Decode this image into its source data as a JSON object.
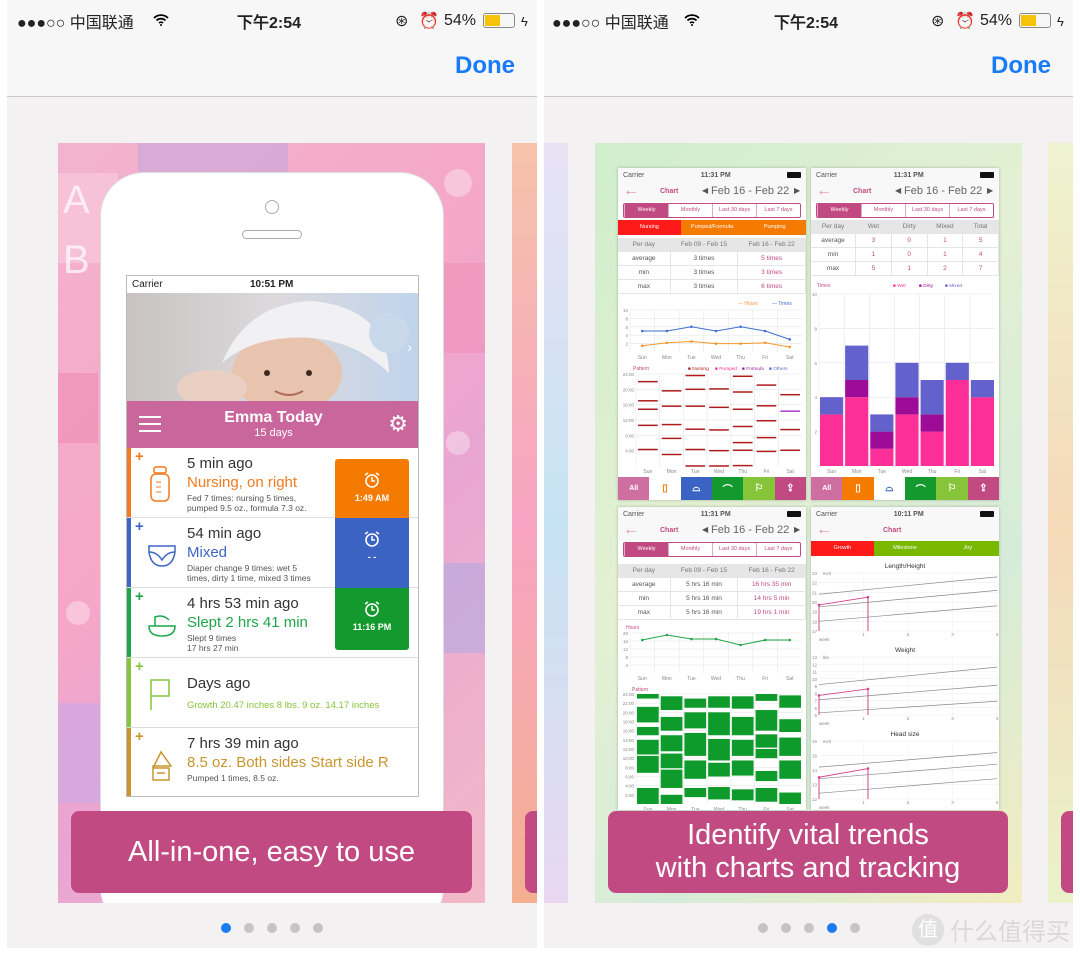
{
  "status_bar": {
    "carrier": "●●●○○ 中国联通",
    "time": "下午2:54",
    "battery": "54%",
    "battery_level": 0.54
  },
  "nav": {
    "done_label": "Done"
  },
  "left_slide": {
    "caption": "All-in-one, easy to use",
    "phone": {
      "carrier": "Carrier",
      "time": "10:51 PM",
      "header_title": "Emma Today",
      "header_subtitle": "15 days",
      "rows": [
        {
          "type": "feeding",
          "color": "#f47a1f",
          "time_ago": "5 min ago",
          "title": "Nursing, on right",
          "detail": "Fed 7 times: nursing 5 times,",
          "detail2": "pumped 9.5 oz., formula 7.3 oz.",
          "alarm": "1:49 AM",
          "alarm_color": "#f47a00"
        },
        {
          "type": "diaper",
          "color": "#3d66c4",
          "time_ago": "54 min ago",
          "title": "Mixed",
          "detail": "Diaper change 9 times: wet 5",
          "detail2": "times, dirty 1 time, mixed 3 times",
          "alarm": "- -",
          "alarm_color": "#3a63c3"
        },
        {
          "type": "sleep",
          "color": "#1fa64a",
          "time_ago": "4 hrs 53 min ago",
          "title": "Slept 2 hrs 41 min",
          "detail": "Slept 9 times",
          "detail2": "17 hrs 27 min",
          "alarm": "11:16 PM",
          "alarm_color": "#14992f"
        },
        {
          "type": "growth",
          "color": "#86c43a",
          "time_ago": "Days ago",
          "title": "",
          "detail": "Growth 20.47 inches 8 lbs. 9 oz. 14.17 inches",
          "detail2": ""
        },
        {
          "type": "pumping",
          "color": "#c9962e",
          "time_ago": "7 hrs 39 min ago",
          "title": "8.5 oz.  Both sides  Start side R",
          "detail": "Pumped 1 times, 8.5 oz.",
          "detail2": ""
        }
      ]
    },
    "page_dots": {
      "count": 5,
      "active": 0
    }
  },
  "right_slide": {
    "caption_line1": "Identify vital trends",
    "caption_line2": "with charts and tracking",
    "page_dots": {
      "count": 5,
      "active": 3
    },
    "screens": {
      "common": {
        "carrier": "Carrier",
        "chart_title": "Chart",
        "date_range": "Feb 16 - Feb 22",
        "segments": [
          "Weekly",
          "Monthly",
          "Last 30 days",
          "Last 7 days"
        ],
        "bottom_tabs": [
          "All"
        ]
      },
      "feeding": {
        "time": "11:31 PM",
        "tabs": [
          "Nursing",
          "Pumped/Formula",
          "Pumping"
        ],
        "table_header": [
          "Per day",
          "Feb 09 - Feb 15",
          "Feb 16 - Feb 22"
        ],
        "table_rows": [
          [
            "average",
            "3 times",
            "5 times"
          ],
          [
            "min",
            "3 times",
            "3 times"
          ],
          [
            "max",
            "3 times",
            "6 times"
          ]
        ]
      },
      "diaper": {
        "time": "11:31 PM",
        "table_header": [
          "Per day",
          "Wet",
          "Dirty",
          "Mixed",
          "Total"
        ],
        "table_rows": [
          [
            "average",
            "3",
            "0",
            "1",
            "5"
          ],
          [
            "min",
            "1",
            "0",
            "1",
            "4"
          ],
          [
            "max",
            "5",
            "1",
            "2",
            "7"
          ]
        ]
      },
      "sleep": {
        "time": "11:31 PM",
        "table_header": [
          "Per day",
          "Feb 09 - Feb 15",
          "Feb 16 - Feb 22"
        ],
        "table_rows": [
          [
            "average",
            "5 hrs 16 min",
            "16 hrs 35 min"
          ],
          [
            "min",
            "5 hrs 16 min",
            "14 hrs 5 min"
          ],
          [
            "max",
            "5 hrs 16 min",
            "19 hrs 1 min"
          ]
        ]
      },
      "growth": {
        "time": "10:11 PM",
        "tabs": [
          "Growth",
          "Milestone",
          "Joy"
        ]
      }
    }
  },
  "watermark": "什么值得买",
  "colors": {
    "accent": "#1a7cf5",
    "brand_pink": "#c24a82",
    "feeding": "#f47a00",
    "diaper": "#3a63c3",
    "sleep": "#14992f",
    "growth": "#86c43a",
    "pumping": "#c9962e"
  },
  "chart_data": [
    {
      "id": "feeding-line",
      "type": "line",
      "categories": [
        "Sun",
        "Mon",
        "Tue",
        "Wed",
        "Thu",
        "Fri",
        "Sat"
      ],
      "ylim": [
        0,
        10
      ],
      "yticks": [
        2,
        4,
        6,
        8,
        10
      ],
      "series": [
        {
          "name": "Hours",
          "color": "#f5962e",
          "values": [
            1.5,
            2.2,
            2.5,
            2,
            2,
            2.2,
            1.2
          ]
        },
        {
          "name": "Times",
          "color": "#3e6fd0",
          "values": [
            5,
            5,
            6,
            5,
            6,
            5,
            3
          ]
        }
      ]
    },
    {
      "id": "feeding-pattern",
      "type": "scatter",
      "title": "Pattern",
      "categories": [
        "Sun",
        "Mon",
        "Tue",
        "Wed",
        "Thu",
        "Fri",
        "Sat"
      ],
      "ylim": [
        0,
        24
      ],
      "yticks": [
        "4:00",
        "8:00",
        "12:00",
        "16:00",
        "20:00",
        "24:00"
      ],
      "legend": [
        {
          "name": "Nursing",
          "color": "#b01c1c"
        },
        {
          "name": "Pumped",
          "color": "#f0308f"
        },
        {
          "name": "Formula",
          "color": "#9a1a9a"
        },
        {
          "name": "Others",
          "color": "#5a6ad0"
        }
      ],
      "marks": [
        [
          22.2,
          17.2,
          15,
          10.8,
          4.5
        ],
        [
          19.8,
          15.8,
          11,
          7.4,
          3.2
        ],
        [
          23.8,
          20.2,
          15.8,
          9.8,
          4.5,
          0.2
        ],
        [
          20.3,
          15.5,
          9.6,
          4.2,
          0.2
        ],
        [
          23.6,
          19.5,
          15,
          10.5,
          6.3,
          4.3,
          0.3
        ],
        [
          21.3,
          15.9,
          12,
          7.6,
          4
        ],
        [
          18.8,
          14.5,
          9.7,
          4.3
        ]
      ]
    },
    {
      "id": "diaper-bars",
      "type": "bar",
      "title": "Times",
      "categories": [
        "Sun",
        "Mon",
        "Tue",
        "Wed",
        "Thu",
        "Fri",
        "Sat"
      ],
      "ylim": [
        0,
        10
      ],
      "yticks": [
        2,
        4,
        6,
        8,
        10
      ],
      "series": [
        {
          "name": "Wet",
          "color": "#fb2f97",
          "values": [
            3,
            4,
            1,
            3,
            2,
            5,
            4
          ]
        },
        {
          "name": "Dirty",
          "color": "#9c0c96",
          "values": [
            0,
            1,
            1,
            1,
            1,
            0,
            0
          ]
        },
        {
          "name": "Mixed",
          "color": "#6361cc",
          "values": [
            1,
            2,
            1,
            2,
            2,
            1,
            1
          ]
        }
      ]
    },
    {
      "id": "sleep-line",
      "type": "line",
      "ylabel": "Hours",
      "categories": [
        "Sun",
        "Mon",
        "Tue",
        "Wed",
        "Thu",
        "Fri",
        "Sat"
      ],
      "ylim": [
        0,
        20
      ],
      "yticks": [
        4,
        8,
        12,
        16,
        20
      ],
      "series": [
        {
          "color": "#1fa64a",
          "values": [
            16.5,
            19,
            17,
            17,
            14,
            16.5,
            16.5
          ]
        }
      ]
    },
    {
      "id": "sleep-pattern",
      "type": "bar",
      "title": "Pattern",
      "categories": [
        "Sun",
        "Mon",
        "Tue",
        "Wed",
        "Thu",
        "Fri",
        "Sat"
      ],
      "ylim": [
        0,
        24
      ],
      "yticks": [
        "2:00",
        "4:00",
        "6:00",
        "8:00",
        "10:00",
        "12:00",
        "14:00",
        "16:00",
        "18:00",
        "20:00",
        "22:00",
        "24:00"
      ],
      "blocks": [
        [
          [
            0,
            3.5
          ],
          [
            6.8,
            10.5
          ],
          [
            10.8,
            14
          ],
          [
            15,
            16.8
          ],
          [
            17.8,
            21.2
          ],
          [
            23,
            24
          ]
        ],
        [
          [
            0,
            2
          ],
          [
            3.5,
            7.5
          ],
          [
            7.8,
            11
          ],
          [
            11.5,
            15
          ],
          [
            16,
            19
          ],
          [
            20.5,
            23.5
          ]
        ],
        [
          [
            1.5,
            3.5
          ],
          [
            5.5,
            9.5
          ],
          [
            10.5,
            15.5
          ],
          [
            16.5,
            20
          ],
          [
            21,
            23
          ]
        ],
        [
          [
            1,
            3.7
          ],
          [
            6,
            9
          ],
          [
            9.5,
            14.2
          ],
          [
            15,
            20
          ],
          [
            21,
            23.5
          ]
        ],
        [
          [
            0.8,
            3.2
          ],
          [
            6.2,
            9.5
          ],
          [
            10.5,
            14
          ],
          [
            15,
            19
          ],
          [
            20.8,
            23.5
          ]
        ],
        [
          [
            0.5,
            3.5
          ],
          [
            5,
            7.2
          ],
          [
            10,
            12
          ],
          [
            12.3,
            15.2
          ],
          [
            16,
            20.5
          ],
          [
            22.5,
            24
          ]
        ],
        [
          [
            0,
            2.5
          ],
          [
            5.5,
            9.5
          ],
          [
            10.5,
            14.5
          ],
          [
            15.7,
            18.5
          ],
          [
            21,
            23.7
          ]
        ]
      ]
    },
    {
      "id": "growth-length",
      "type": "line",
      "title": "Length/Height",
      "ylabel": "inch",
      "xlabel": "week",
      "xlim": [
        0,
        4
      ],
      "xticks": [
        1,
        2,
        3,
        4
      ],
      "ylim": [
        17,
        23
      ],
      "yticks": [
        17,
        18,
        19,
        20,
        21,
        22,
        23
      ],
      "percentiles": [
        [
          20.8,
          22.6
        ],
        [
          19.5,
          21.2
        ],
        [
          18,
          19.6
        ]
      ],
      "series": [
        {
          "color": "#d3458e",
          "x": [
            0,
            1.1
          ],
          "values": [
            19.7,
            20.5
          ]
        }
      ]
    },
    {
      "id": "growth-weight",
      "type": "line",
      "title": "Weight",
      "ylabel": "lbs.",
      "xlabel": "week",
      "xlim": [
        0,
        4
      ],
      "xticks": [
        1,
        2,
        3,
        4
      ],
      "ylim": [
        5,
        13
      ],
      "yticks": [
        5,
        6,
        7,
        8,
        9,
        10,
        11,
        12,
        13
      ],
      "percentiles": [
        [
          9.2,
          11.6
        ],
        [
          7.1,
          9.1
        ],
        [
          5.3,
          6.9
        ]
      ],
      "series": [
        {
          "color": "#d3458e",
          "x": [
            0,
            1.1
          ],
          "values": [
            7.7,
            8.6
          ]
        }
      ]
    },
    {
      "id": "growth-head",
      "type": "line",
      "title": "Head size",
      "ylabel": "inch",
      "xlabel": "week",
      "xlim": [
        0,
        4
      ],
      "xticks": [
        1,
        2,
        3,
        4
      ],
      "ylim": [
        12,
        16
      ],
      "yticks": [
        12,
        13,
        14,
        15,
        16
      ],
      "percentiles": [
        [
          14.2,
          15.2
        ],
        [
          13.4,
          14.4
        ],
        [
          12.4,
          13.4
        ]
      ],
      "series": [
        {
          "color": "#d3458e",
          "x": [
            0,
            1.1
          ],
          "values": [
            13.5,
            14.1
          ]
        }
      ]
    }
  ]
}
